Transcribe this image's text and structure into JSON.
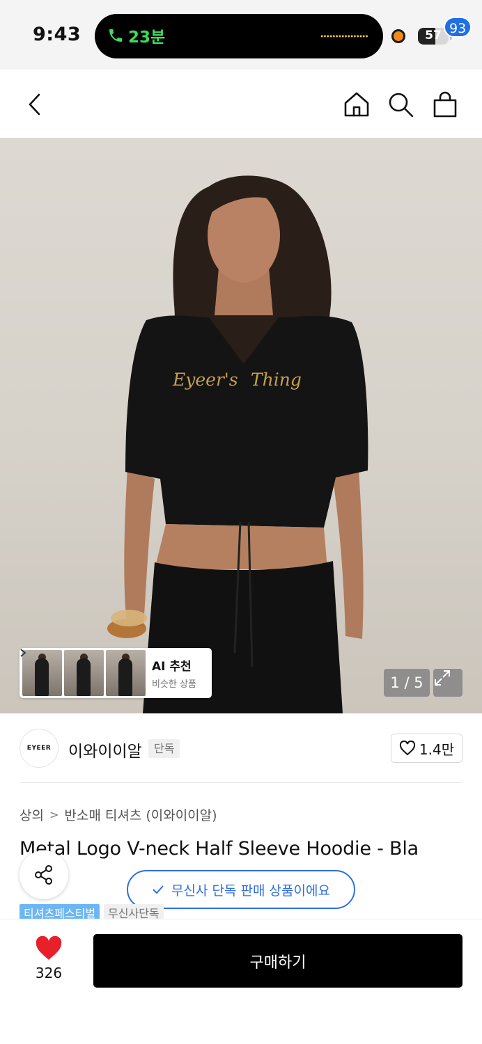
{
  "status_bar": {
    "time": "9:43",
    "call_duration": "23분",
    "battery": "57",
    "battery_level": 0.57
  },
  "nav": {
    "cart_count": "93",
    "icons": [
      "back-icon",
      "home-icon",
      "search-icon",
      "cart-icon"
    ]
  },
  "gallery": {
    "counter": "1 / 5",
    "ai_title": "AI 추천",
    "ai_subtitle": "비슷한 상품"
  },
  "brand": {
    "logo_text": "EYEER",
    "name": "이와이이알",
    "tag": "단독",
    "likes": "1.4만"
  },
  "breadcrumb": [
    "상의",
    "반소매 티셔츠 (이와이이알)"
  ],
  "product": {
    "title": "Metal Logo V-neck Half Sleeve Hoodie - Bla",
    "exclusive_notice": "무신사 단독 판매 상품이에요",
    "tags": [
      "티셔츠페스티벌",
      "무신사단독"
    ]
  },
  "bottom_bar": {
    "like_count": "326",
    "buy_label": "구매하기"
  },
  "colors": {
    "accent_blue": "#2f6ee0",
    "badge_blue": "#1f6fe5",
    "heart_red": "#e8202a",
    "call_green": "#3ddc5c"
  }
}
